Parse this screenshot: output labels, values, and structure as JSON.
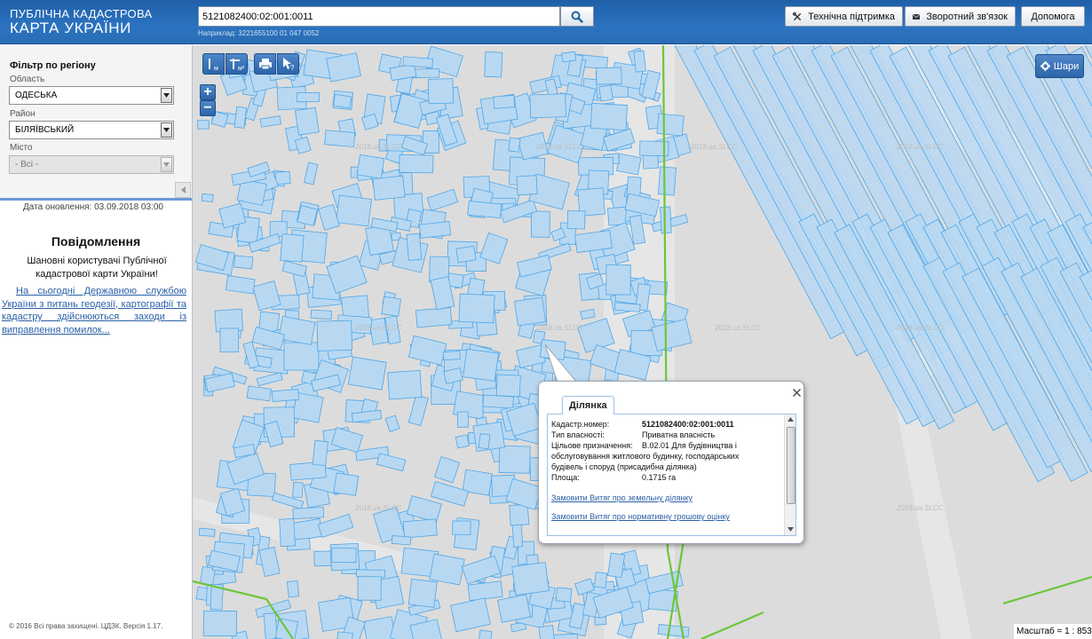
{
  "header": {
    "logo_line1": "ПУБЛІЧНА КАДАСТРОВА",
    "logo_line2": "КАРТА УКРАЇНИ",
    "search_value": "5121082400:02:001:0011",
    "search_example": "Наприклад: 3221655100 01 047 0052",
    "support_label": "Технічна підтримка",
    "feedback_label": "Зворотний зв'язок",
    "help_label": "Допомога"
  },
  "sidebar": {
    "filter_title": "Фільтр по регіону",
    "region_label": "Область",
    "region_value": "ОДЕСЬКА",
    "district_label": "Район",
    "district_value": "БІЛЯЇВСЬКИЙ",
    "city_label": "Місто",
    "city_value": "- Всі -",
    "updated": "Дата оновлення: 03.09.2018 03:00",
    "notice_title": "Повідомлення",
    "notice_greeting": "Шановні користувачі Публічної кадастрової карти України!",
    "notice_link": "На сьогодні Державною службою України з питань геодезії, картографії та кадастру здійснюються заходи із виправлення помилок...",
    "copyright": "© 2016 Всі права захищені. ЦДЗК. Версія 1.17."
  },
  "map": {
    "tool_icons": [
      "measure-distance-icon",
      "measure-area-icon",
      "print-icon",
      "identify-icon"
    ],
    "layers_label": "Шари",
    "scale_text": "Масштаб = 1 : 8531",
    "watermark": "2018.ua.SLCC"
  },
  "popup": {
    "tab_label": "Ділянка",
    "rows": [
      {
        "key": "Кадастр.номер:",
        "value": "5121082400:02:001:0011"
      },
      {
        "key": "Тип власності:",
        "value": "Приватна власність"
      },
      {
        "key": "Цільове призначення:",
        "value": "В.02.01 Для будівництва і"
      },
      {
        "key": "Площа:",
        "value": "0.1715 га"
      }
    ],
    "purpose_cont1": "обслуговування житлового будинку, господарських",
    "purpose_cont2": "будівель і споруд (присадибна ділянка)",
    "link_extract": "Замовити Витяг про земельну ділянку",
    "link_valuation": "Замовити Витяг про нормативну грошову оцінку"
  },
  "colors": {
    "header_blue": "#2b73c0",
    "parcel_fill": "#b8d8f2",
    "parcel_stroke": "#4fa6e6",
    "road_green": "#6cc63a",
    "link": "#2a5fa6"
  }
}
